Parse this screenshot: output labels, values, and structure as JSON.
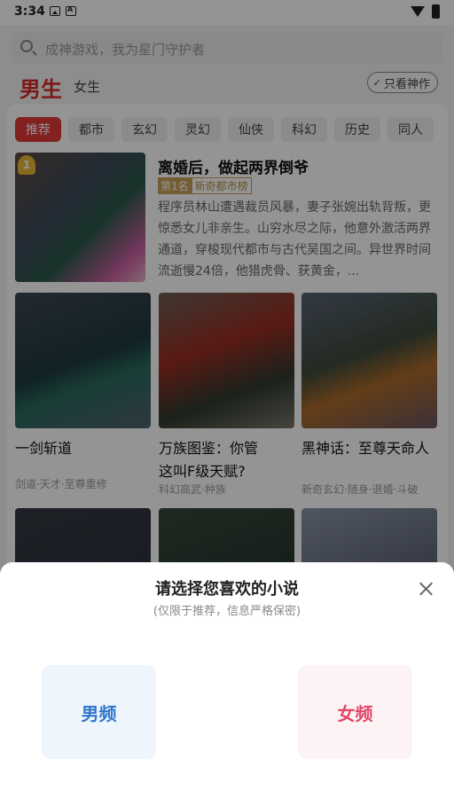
{
  "status": {
    "time": "3:34"
  },
  "search": {
    "placeholder": "成神游戏，我为星门守护者"
  },
  "tabs": {
    "male": "男生",
    "female": "女生",
    "only_works": "只看神作"
  },
  "categories": [
    "推荐",
    "都市",
    "玄幻",
    "灵幻",
    "仙侠",
    "科幻",
    "历史",
    "同人"
  ],
  "featured": {
    "rank_badge": "1",
    "title": "离婚后，做起两界倒爷",
    "rank_label": "第1名",
    "rank_list": "新奇都市榜",
    "description": "程序员林山遭遇裁员风暴，妻子张婉出轨背叛，更惊悉女儿非亲生。山穷水尽之际，他意外激活两界通道，穿梭现代都市与古代吴国之间。异世界时间流逝慢24倍，他猎虎骨、获黄金，..."
  },
  "books": [
    {
      "title": "一剑斩道",
      "tags": "剑道·天才·至尊重修"
    },
    {
      "title": "万族图鉴：你管这叫F级天赋?",
      "tags": "科幻高武·种族"
    },
    {
      "title": "黑神话：至尊天命人",
      "tags": "新奇玄幻·随身·退婚·斗破"
    }
  ],
  "sheet": {
    "title": "请选择您喜欢的小说",
    "subtitle": "(仅限于推荐，信息严格保密)",
    "male_option": "男频",
    "female_option": "女频"
  },
  "colors": {
    "accent": "#e23a3a",
    "male": "#2f76c9",
    "female": "#e2476a"
  }
}
